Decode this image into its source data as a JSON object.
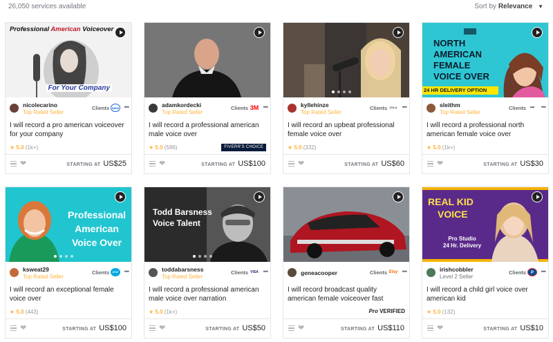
{
  "results": {
    "count_text": "26,050 services available",
    "sort_label": "Sort by",
    "sort_value": "Relevance"
  },
  "price_prefix": "STARTING AT",
  "clients_label": "Clients",
  "gigs": [
    {
      "username": "nicolecarino",
      "level": "Top Rated Seller",
      "client_logo": "BMW",
      "title": "I will record a pro american voiceover for your company",
      "rating": "5.0",
      "reviews": "(1k+)",
      "price": "US$25",
      "thumb_text_top_1": "Professional ",
      "thumb_text_top_2": "American",
      "thumb_text_top_3": " Voiceover",
      "thumb_text_bottom": "For Your Company",
      "extra_badge": ""
    },
    {
      "username": "adamkordecki",
      "level": "Top Rated Seller",
      "client_logo": "3M",
      "title": "I will record a professional american male voice over",
      "rating": "5.0",
      "reviews": "(586)",
      "price": "US$100",
      "extra_badge": "FIVERR'S CHOICE"
    },
    {
      "username": "kyllehinze",
      "level": "Top Rated Seller",
      "client_logo": "ZOLA",
      "title": "I will record an upbeat professional female voice over",
      "rating": "5.0",
      "reviews": "(332)",
      "price": "US$60",
      "extra_badge": ""
    },
    {
      "username": "sleithm",
      "level": "Top Rated Seller",
      "client_logo": "•••",
      "title": "I will record a professional north american female voice over",
      "rating": "5.0",
      "reviews": "(1k+)",
      "price": "US$30",
      "thumb_lines": [
        "NORTH",
        "AMERICAN",
        "FEMALE",
        "VOICE OVER"
      ],
      "thumb_strip": "24 HR DELIVERY OPTION",
      "extra_badge": ""
    },
    {
      "username": "ksweat29",
      "level": "Top Rated Seller",
      "client_logo": "AT&T",
      "title": "I will record an exceptional female voice over",
      "rating": "5.0",
      "reviews": "(443)",
      "price": "US$100",
      "thumb_lines": [
        "Professional",
        "American",
        "Voice Over"
      ],
      "extra_badge": ""
    },
    {
      "username": "toddabarsness",
      "level": "Top Rated Seller",
      "client_logo": "VISA",
      "title": "I will record a professional american male voice over narration",
      "rating": "5.0",
      "reviews": "(1k+)",
      "price": "US$50",
      "thumb_lines": [
        "Todd Barsness",
        "Voice Talent"
      ],
      "extra_badge": ""
    },
    {
      "username": "geneacooper",
      "level": "",
      "client_logo": "Etsy",
      "title": "I will record broadcast quality american female voiceover fast",
      "rating": "",
      "reviews": "",
      "price": "US$110",
      "extra_badge": "",
      "pro_badge_mark": "Pro",
      "pro_badge": "VERIFIED"
    },
    {
      "username": "irishcobbler",
      "level": "Level 2 Seller",
      "client_logo": "P",
      "title": "I will record a child girl voice over american kid",
      "rating": "5.0",
      "reviews": "(132)",
      "price": "US$10",
      "thumb_lines": [
        "REAL KID",
        "VOICE",
        "Pro Studio",
        "24 Hr. Delivery"
      ],
      "extra_badge": ""
    }
  ]
}
